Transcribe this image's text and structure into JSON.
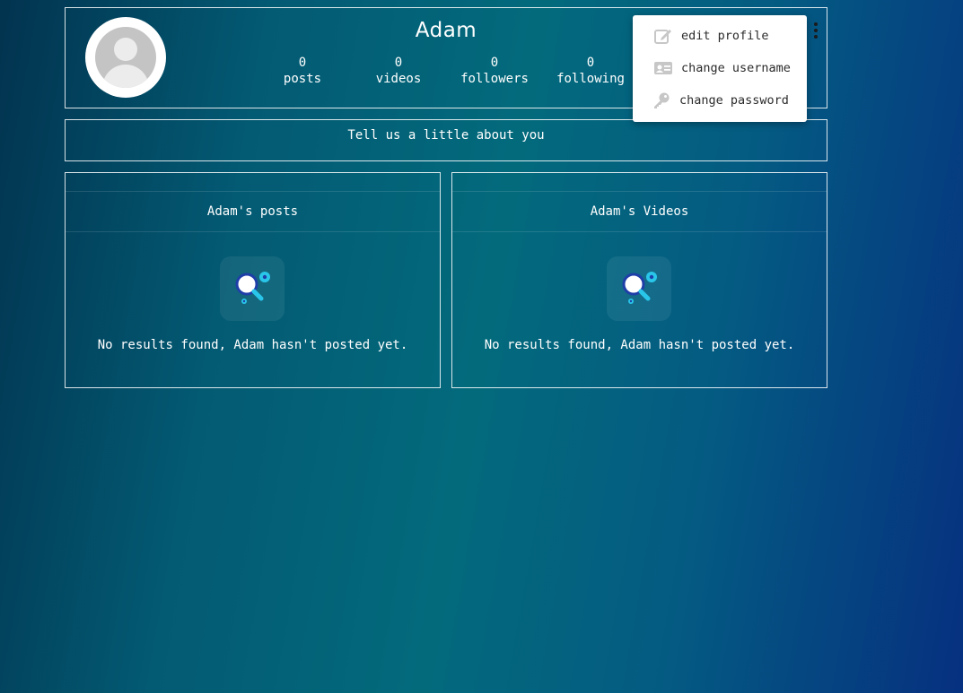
{
  "profile": {
    "username": "Adam",
    "stats": [
      {
        "count": "0",
        "label": "posts"
      },
      {
        "count": "0",
        "label": "videos"
      },
      {
        "count": "0",
        "label": "followers"
      },
      {
        "count": "0",
        "label": "following"
      }
    ]
  },
  "about": {
    "prompt": "Tell us a little about you"
  },
  "posts_section": {
    "title": "Adam's posts",
    "empty_message": "No results found, Adam hasn't posted yet."
  },
  "videos_section": {
    "title": "Adam's Videos",
    "empty_message": "No results found, Adam hasn't posted yet."
  },
  "menu": {
    "items": [
      {
        "label": "edit profile",
        "icon": "edit-icon"
      },
      {
        "label": "change username",
        "icon": "id-card-icon"
      },
      {
        "label": "change password",
        "icon": "key-icon"
      }
    ]
  },
  "colors": {
    "accent_cyan": "#29c6ea",
    "magnifier_blue": "#1f3fa8",
    "menu_icon_gray": "#c7c7c7"
  }
}
